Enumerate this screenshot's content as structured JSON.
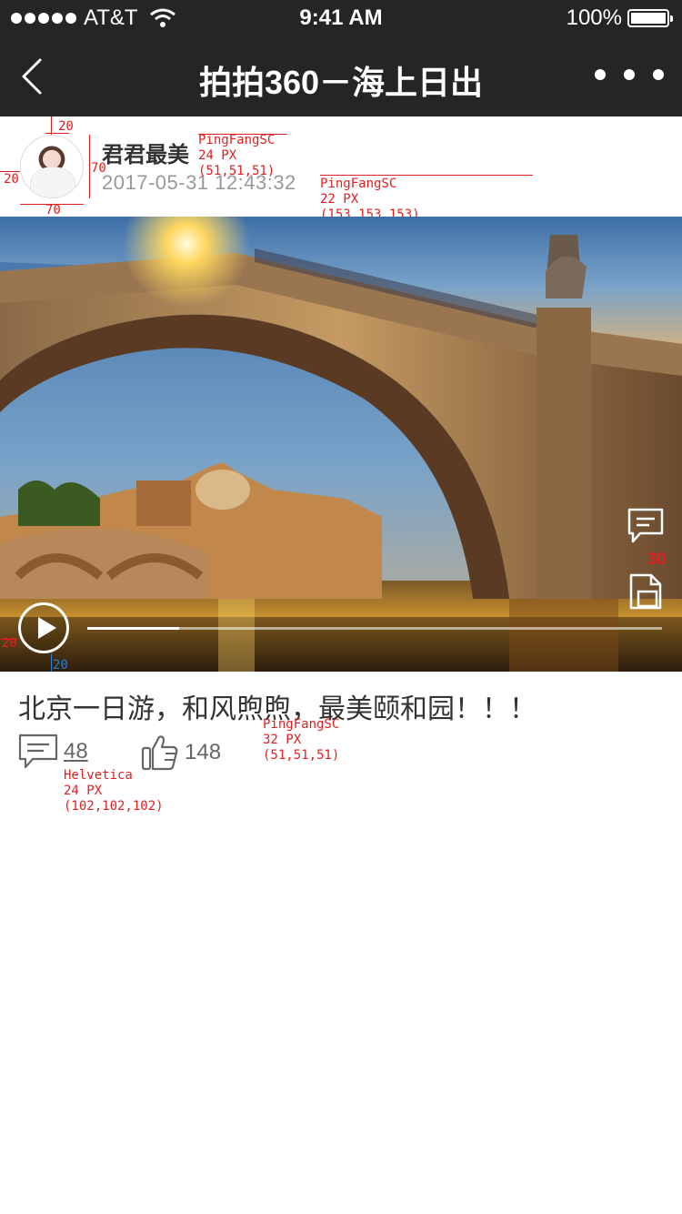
{
  "status_bar": {
    "carrier": "AT&T",
    "time": "9:41 AM",
    "battery": "100%"
  },
  "nav": {
    "title": "拍拍360－海上日出",
    "back_icon": "chevron-left-icon",
    "more_icon": "more-dots-icon"
  },
  "author": {
    "name": "君君最美",
    "timestamp": "2017-05-31   12:43:32",
    "avatar_icon": "avatar"
  },
  "annotations": {
    "avatar_top": "20",
    "avatar_left": "20",
    "avatar_height": "70",
    "avatar_width": "70",
    "name_spec": [
      "PingFangSC",
      "24 PX",
      "(51,51,51)"
    ],
    "time_spec": [
      "PingFangSC",
      "22 PX",
      "(153,153,153)"
    ],
    "side_spacing": "30",
    "play_left": "20",
    "play_bottom": "20",
    "title_spec": [
      "PingFangSC",
      "32 PX",
      "(51,51,51)"
    ],
    "count_spec": [
      "Helvetica",
      "24 PX",
      "(102,102,102)"
    ]
  },
  "video": {
    "progress_fraction": 0.16,
    "play_icon": "play-icon",
    "side_comment_icon": "comment-icon",
    "side_share_icon": "share-icon"
  },
  "post": {
    "title": "北京一日游，和风煦煦，最美颐和园！！！",
    "comment_count": "48",
    "like_count": "148"
  },
  "colors": {
    "bar_bg": "#252525",
    "annotation": "#e02020",
    "name_text": "#333333",
    "time_text": "#999999",
    "count_text": "#666666"
  }
}
